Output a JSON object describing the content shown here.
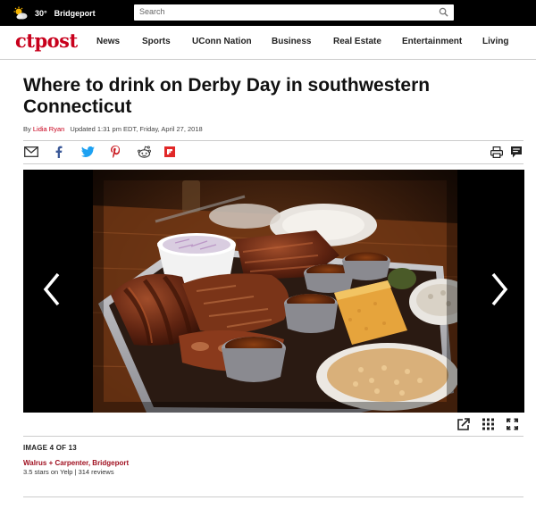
{
  "weather": {
    "temp": "30°",
    "city": "Bridgeport",
    "icon": "partly-cloudy-icon"
  },
  "search": {
    "placeholder": "Search",
    "icon": "search-icon"
  },
  "brand": {
    "logo": "ctpost",
    "color": "#c8001c"
  },
  "nav": {
    "items": [
      {
        "label": "News"
      },
      {
        "label": "Sports"
      },
      {
        "label": "UConn Nation"
      },
      {
        "label": "Business"
      },
      {
        "label": "Real Estate"
      },
      {
        "label": "Entertainment"
      },
      {
        "label": "Living"
      }
    ]
  },
  "article": {
    "title_line1": "Where to drink on Derby Day in southwestern",
    "title_line2": "Connecticut",
    "byline_prefix": "By",
    "author": "Lidia Ryan",
    "updated": "Updated 1:31 pm EDT, Friday, April 27, 2018"
  },
  "share": [
    {
      "icon": "email-icon"
    },
    {
      "icon": "facebook-icon"
    },
    {
      "icon": "twitter-icon"
    },
    {
      "icon": "pinterest-icon"
    },
    {
      "icon": "reddit-icon"
    },
    {
      "icon": "flipboard-icon"
    },
    {
      "icon": "print-icon"
    },
    {
      "icon": "comment-icon"
    }
  ],
  "gallery": {
    "image_index": "IMAGE 4 OF 13",
    "caption_title": "Walrus + Carpenter, Bridgeport",
    "caption_sub": "3.5 stars on Yelp | 314 reviews",
    "tools": [
      {
        "icon": "external-link-icon"
      },
      {
        "icon": "grid-icon"
      },
      {
        "icon": "fullscreen-icon"
      }
    ]
  }
}
